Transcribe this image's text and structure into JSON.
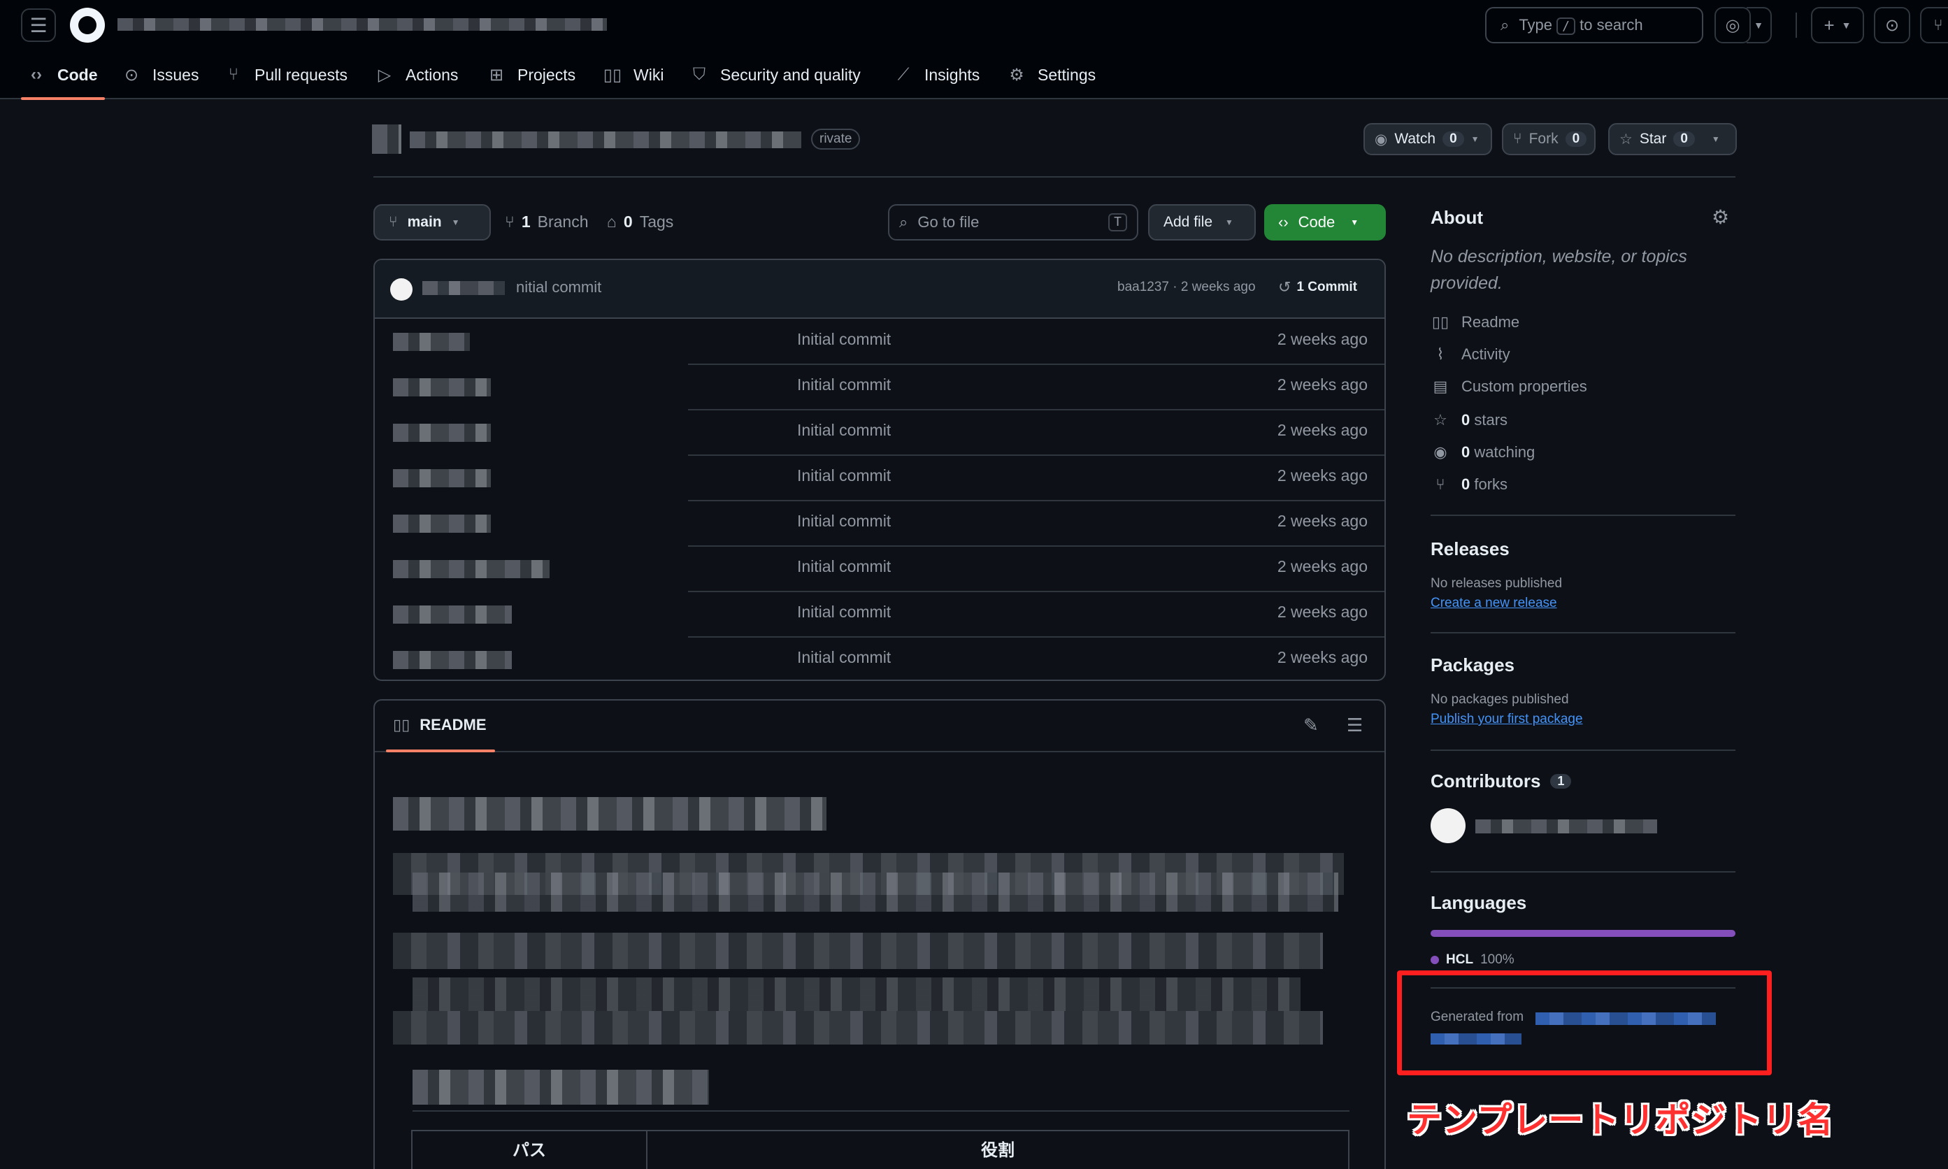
{
  "header": {
    "search_prefix": "Type",
    "search_key": "/",
    "search_suffix": "to search"
  },
  "tabs": [
    {
      "label": "Code",
      "icon": "code-icon"
    },
    {
      "label": "Issues",
      "icon": "issue-icon"
    },
    {
      "label": "Pull requests",
      "icon": "pull-request-icon"
    },
    {
      "label": "Actions",
      "icon": "play-icon"
    },
    {
      "label": "Projects",
      "icon": "table-icon"
    },
    {
      "label": "Wiki",
      "icon": "book-icon"
    },
    {
      "label": "Security and quality",
      "icon": "shield-icon"
    },
    {
      "label": "Insights",
      "icon": "graph-icon"
    },
    {
      "label": "Settings",
      "icon": "gear-icon"
    }
  ],
  "repo": {
    "visibility": "rivate",
    "watch_label": "Watch",
    "watch_count": "0",
    "fork_label": "Fork",
    "fork_count": "0",
    "star_label": "Star",
    "star_count": "0"
  },
  "toolbar": {
    "branch": "main",
    "branch_count": "1",
    "branch_label": "Branch",
    "tag_count": "0",
    "tag_label": "Tags",
    "goto_placeholder": "Go to file",
    "goto_key": "T",
    "add_file": "Add file",
    "code": "Code"
  },
  "commit_header": {
    "message": "nitial commit",
    "hash_time": "baa1237 · 2 weeks ago",
    "commits": "1 Commit"
  },
  "files": [
    {
      "message": "Initial commit",
      "time": "2 weeks ago"
    },
    {
      "message": "Initial commit",
      "time": "2 weeks ago"
    },
    {
      "message": "Initial commit",
      "time": "2 weeks ago"
    },
    {
      "message": "Initial commit",
      "time": "2 weeks ago"
    },
    {
      "message": "Initial commit",
      "time": "2 weeks ago"
    },
    {
      "message": "Initial commit",
      "time": "2 weeks ago"
    },
    {
      "message": "Initial commit",
      "time": "2 weeks ago"
    },
    {
      "message": "Initial commit",
      "time": "2 weeks ago"
    }
  ],
  "readme": {
    "tab_label": "README",
    "table_headers": [
      "パス",
      "役割"
    ]
  },
  "about": {
    "title": "About",
    "description": "No description, website, or topics provided.",
    "items": [
      {
        "icon": "book-icon",
        "label": "Readme"
      },
      {
        "icon": "pulse-icon",
        "label": "Activity"
      },
      {
        "icon": "note-icon",
        "label": "Custom properties"
      },
      {
        "icon": "star-icon",
        "count": "0",
        "label": "stars"
      },
      {
        "icon": "eye-icon",
        "count": "0",
        "label": "watching"
      },
      {
        "icon": "fork-icon",
        "count": "0",
        "label": "forks"
      }
    ]
  },
  "releases": {
    "title": "Releases",
    "status": "No releases published",
    "link": "Create a new release"
  },
  "packages": {
    "title": "Packages",
    "status": "No packages published",
    "link": "Publish your first package"
  },
  "contributors": {
    "title": "Contributors",
    "count": "1"
  },
  "languages": {
    "title": "Languages",
    "name": "HCL",
    "percent": "100%",
    "color": "#844fba"
  },
  "generated": {
    "label": "Generated from"
  },
  "annotation": {
    "text": "テンプレートリポジトリ名",
    "color": "#ff1f1f"
  }
}
